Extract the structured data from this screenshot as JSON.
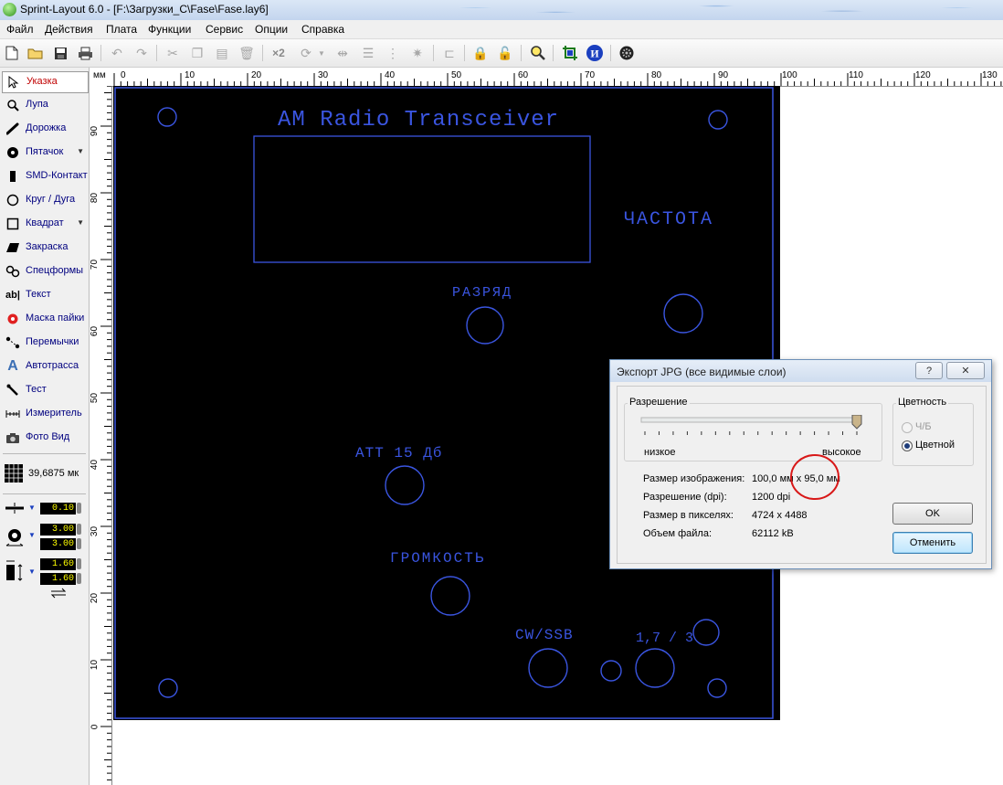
{
  "window": {
    "title": "Sprint-Layout 6.0 - [F:\\Загрузки_C\\Fase\\Fase.lay6]"
  },
  "menu": [
    "Файл",
    "Действия",
    "Плата",
    "Функции",
    "Сервис",
    "Опции",
    "Справка"
  ],
  "toolbar": {
    "icons": [
      "new-file-icon",
      "open-folder-icon",
      "save-icon",
      "print-icon",
      "undo-icon",
      "redo-icon",
      "cut-icon",
      "copy-icon",
      "paste-icon",
      "delete-icon",
      "duplicate-x2-icon",
      "rotate-icon",
      "mirror-icon",
      "align-icon",
      "distribute-icon",
      "group-icon",
      "lock-icon",
      "unlock-icon",
      "component-icon",
      "zoom-icon",
      "crop-icon",
      "info-icon",
      "settings-icon"
    ],
    "x2_label": "×2"
  },
  "tools": [
    {
      "label": "Указка",
      "icon": "pointer-icon",
      "selected": true
    },
    {
      "label": "Лупа",
      "icon": "magnifier-icon"
    },
    {
      "label": "Дорожка",
      "icon": "track-icon"
    },
    {
      "label": "Пятачок",
      "icon": "pad-icon",
      "dropdown": true
    },
    {
      "label": "SMD-Контакт",
      "icon": "smd-icon"
    },
    {
      "label": "Круг / Дуга",
      "icon": "circle-icon"
    },
    {
      "label": "Квадрат",
      "icon": "square-icon",
      "dropdown": true
    },
    {
      "label": "Закраска",
      "icon": "fill-icon"
    },
    {
      "label": "Спецформы",
      "icon": "special-shapes-icon"
    },
    {
      "label": "Текст",
      "icon": "text-icon",
      "icon_text": "ab|"
    },
    {
      "label": "Маска пайки",
      "icon": "solder-mask-icon"
    },
    {
      "label": "Перемычки",
      "icon": "jumper-icon"
    },
    {
      "label": "Автотрасса",
      "icon": "autoroute-icon",
      "icon_text": "A"
    },
    {
      "label": "Тест",
      "icon": "test-icon"
    },
    {
      "label": "Измеритель",
      "icon": "measure-icon"
    },
    {
      "label": "Фото Вид",
      "icon": "photo-view-icon"
    }
  ],
  "grid": {
    "value": "39,6875 мк"
  },
  "params": {
    "track_width": "0.10",
    "pad_outer": "3.00",
    "pad_inner": "3.00",
    "smd_w": "1.60",
    "smd_h": "1.60"
  },
  "ruler": {
    "unit": "мм",
    "top": [
      "0",
      "10",
      "20",
      "30",
      "40",
      "50",
      "60",
      "70",
      "80",
      "90",
      "100",
      "110",
      "120",
      "130"
    ],
    "left": [
      "90",
      "80",
      "70",
      "60",
      "50",
      "40",
      "30",
      "20",
      "10",
      "0"
    ]
  },
  "board": {
    "title": "AM  Radio Transceiver",
    "labels": {
      "frequency": "ЧАСТОТА",
      "range": "РАЗРЯД",
      "att": "АТТ  15 Дб",
      "volume": "ГРОМКОСТЬ",
      "mode": "CW/SSB",
      "ratio": "1,7 / 3"
    },
    "colors": {
      "background": "#000000",
      "lines": "#3a55e0"
    }
  },
  "dialog": {
    "title": "Экспорт JPG (все видимые слои)",
    "help_label": "?",
    "close_label": "✕",
    "resolution_group": "Разрешение",
    "slider_low": "низкое",
    "slider_high": "высокое",
    "slider_level": 1.0,
    "color_group": "Цветность",
    "radio_bw": "Ч/Б",
    "radio_color": "Цветной",
    "selected_radio": "Цветной",
    "rows": [
      {
        "label": "Размер изображения:",
        "value": "100,0 мм x 95,0 мм"
      },
      {
        "label": "Разрешение (dpi):",
        "value": "1200 dpi"
      },
      {
        "label": "Размер в пикселях:",
        "value": "4724 x 4488"
      },
      {
        "label": "Объем файла:",
        "value": "62112 kB"
      }
    ],
    "ok_label": "OK",
    "cancel_label": "Отменить"
  }
}
